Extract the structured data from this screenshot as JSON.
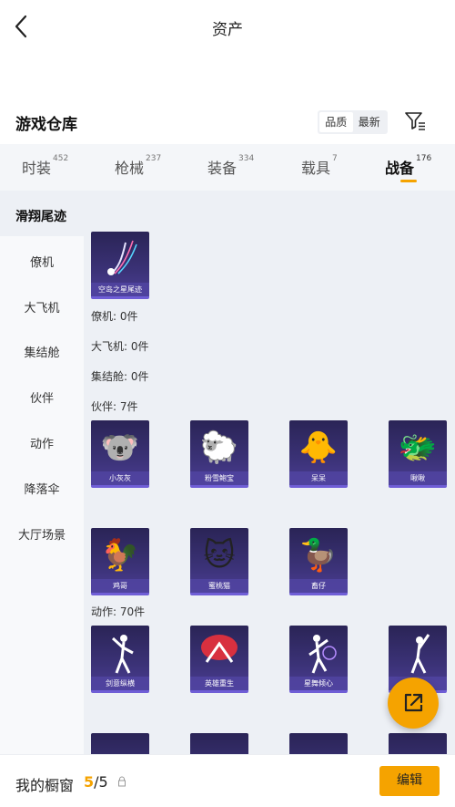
{
  "header": {
    "title": "资产"
  },
  "warehouse": {
    "title": "游戏仓库",
    "sort_options": [
      "品质",
      "最新"
    ],
    "icons": {
      "back": "chevron-left-icon",
      "filter": "filter-icon"
    }
  },
  "tabs": [
    {
      "label": "时装",
      "count": "452"
    },
    {
      "label": "枪械",
      "count": "237"
    },
    {
      "label": "装备",
      "count": "334"
    },
    {
      "label": "载具",
      "count": "7"
    },
    {
      "label": "战备",
      "count": "176"
    }
  ],
  "active_tab": "战备",
  "section": {
    "title": "滑翔尾迹"
  },
  "sidebar": {
    "items": [
      "僚机",
      "大飞机",
      "集结舱",
      "伙伴",
      "动作",
      "降落伞",
      "大厅场景"
    ]
  },
  "glide_trails": [
    {
      "name": "空岛之星尾迹"
    }
  ],
  "category_counts": {
    "wingman": "僚机: 0件",
    "big_plane": "大飞机: 0件",
    "pod": "集结舱: 0件",
    "companion": "伙伴: 7件",
    "emote": "动作: 70件"
  },
  "companions": [
    {
      "name": "小灰灰"
    },
    {
      "name": "粉雪鲍宝"
    },
    {
      "name": "呆呆"
    },
    {
      "name": "啾啾"
    },
    {
      "name": "鸡哥"
    },
    {
      "name": "蜜桃猫"
    },
    {
      "name": "畜仔"
    }
  ],
  "emotes": [
    {
      "name": "剑意纵横"
    },
    {
      "name": "英雄重生"
    },
    {
      "name": "星舞倾心"
    },
    {
      "name": ""
    }
  ],
  "bottom": {
    "showcase_label": "我的橱窗",
    "showcase_current": "5",
    "showcase_total": "/5",
    "edit_label": "编辑"
  },
  "colors": {
    "accent": "#f5a300",
    "card": "#3b3277"
  }
}
